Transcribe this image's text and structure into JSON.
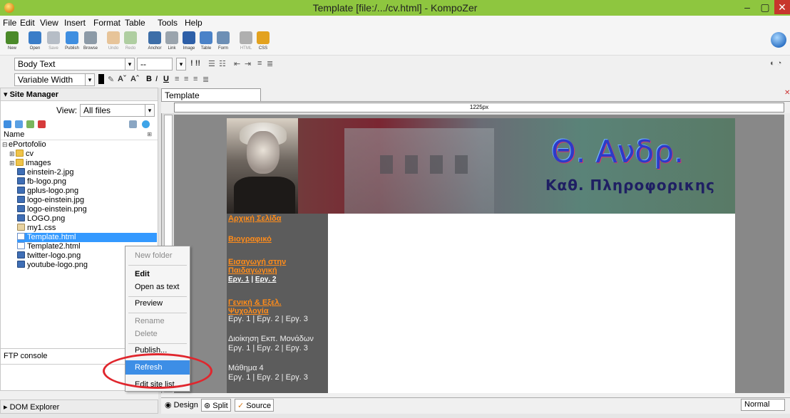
{
  "window": {
    "title": "Template [file:/.../cv.html] - KompoZer",
    "minimize": "–",
    "maximize": "▢",
    "close": "✕"
  },
  "menu": [
    "File",
    "Edit",
    "View",
    "Insert",
    "Format",
    "Table",
    "Tools",
    "Help"
  ],
  "toolbar": {
    "buttons": [
      {
        "label": "New",
        "icon": "new-file-icon",
        "color": "#4b8a2a",
        "enabled": true
      },
      {
        "label": "Open",
        "icon": "folder-open-icon",
        "color": "#3a7dc8",
        "enabled": true
      },
      {
        "label": "Save",
        "icon": "save-icon",
        "color": "#6b7b8f",
        "enabled": false
      },
      {
        "label": "Publish",
        "icon": "publish-icon",
        "color": "#3f8ee0",
        "enabled": true
      },
      {
        "label": "Browse",
        "icon": "browse-icon",
        "color": "#8c9aa7",
        "enabled": true
      },
      {
        "label": "Undo",
        "icon": "undo-icon",
        "color": "#d68a2a",
        "enabled": false
      },
      {
        "label": "Redo",
        "icon": "redo-icon",
        "color": "#5aa03c",
        "enabled": false
      },
      {
        "label": "Anchor",
        "icon": "anchor-icon",
        "color": "#3d6ea8",
        "enabled": true
      },
      {
        "label": "Link",
        "icon": "link-icon",
        "color": "#9aa4ad",
        "enabled": true
      },
      {
        "label": "Image",
        "icon": "image-icon",
        "color": "#2d5fa8",
        "enabled": true
      },
      {
        "label": "Table",
        "icon": "table-icon",
        "color": "#4a82c8",
        "enabled": true
      },
      {
        "label": "Form",
        "icon": "form-icon",
        "color": "#6d8fb5",
        "enabled": true
      },
      {
        "label": "HTML",
        "icon": "html-tag-icon",
        "color": "#5a5a5a",
        "enabled": false
      },
      {
        "label": "CSS",
        "icon": "css-icon",
        "color": "#e3a21f",
        "enabled": true
      }
    ]
  },
  "format": {
    "paragraph": "Body Text",
    "class": "--",
    "font": "Variable Width"
  },
  "site_manager": {
    "title": "Site Manager",
    "view_label": "View:",
    "view_value": "All files",
    "column_name": "Name",
    "root": "ePortofolio",
    "items": [
      {
        "name": "cv",
        "type": "folder"
      },
      {
        "name": "images",
        "type": "folder"
      },
      {
        "name": "einstein-2.jpg",
        "type": "img"
      },
      {
        "name": "fb-logo.png",
        "type": "img"
      },
      {
        "name": "gplus-logo.png",
        "type": "img"
      },
      {
        "name": "logo-einstein.jpg",
        "type": "img"
      },
      {
        "name": "logo-einstein.png",
        "type": "img"
      },
      {
        "name": "LOGO.png",
        "type": "img"
      },
      {
        "name": "my1.css",
        "type": "css"
      },
      {
        "name": "Template.html",
        "type": "html"
      },
      {
        "name": "Template2.html",
        "type": "html"
      },
      {
        "name": "twitter-logo.png",
        "type": "img"
      },
      {
        "name": "youtube-logo.png",
        "type": "img"
      }
    ]
  },
  "context_menu": {
    "new_folder": "New folder",
    "edit": "Edit",
    "open_as_text": "Open as text",
    "preview": "Preview",
    "rename": "Rename",
    "delete": "Delete",
    "publish": "Publish...",
    "refresh": "Refresh",
    "edit_site_list": "Edit site list..."
  },
  "ftp_console": "FTP console",
  "dom_explorer": "DOM Explorer",
  "editor": {
    "tab": "Template",
    "ruler": "1225px",
    "banner_title": "Θ. Ανδρ.",
    "banner_subtitle": "Καθ. Πληροφορικης",
    "nav": {
      "home": "Αρχική Σελίδα",
      "bio": "Βιογραφικό",
      "intro_1": "Εισαγωγή στην",
      "intro_2": "Παιδαγωγική",
      "intro_sub_1": "Εργ. 1",
      "intro_sub_sep": " | ",
      "intro_sub_2": "Εργ. 2",
      "psy_1": "Γενική & Εξελ.",
      "psy_2": "Ψυχολογία",
      "psy_sub": "Εργ. 1 | Εργ. 2 | Εργ. 3",
      "admin": "Διοίκηση Εκπ. Μονάδων",
      "admin_sub": "Εργ. 1 | Εργ. 2 | Εργ. 3",
      "lesson4": "Μάθημα 4",
      "lesson4_sub": "Εργ. 1 | Εργ. 2 | Εργ. 3"
    }
  },
  "modes": {
    "design": "Design",
    "split": "Split",
    "source": "Source",
    "zoom": "Normal"
  }
}
